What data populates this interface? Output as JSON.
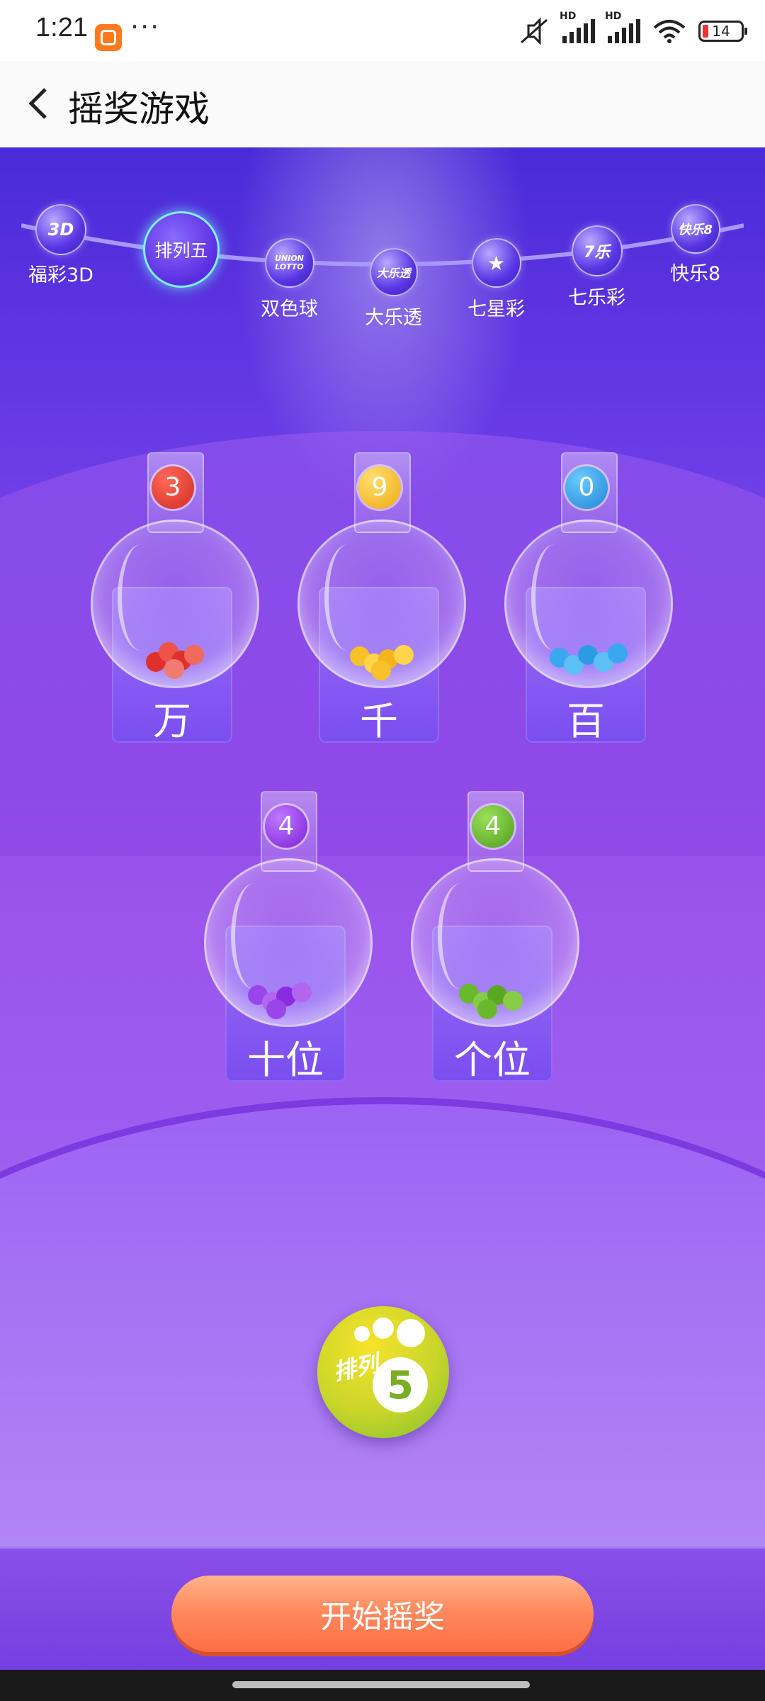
{
  "status_bar": {
    "time": "1:21",
    "dots": "···",
    "battery": "14",
    "signal_label_1": "HD",
    "signal_label_2": "HD"
  },
  "header": {
    "title": "摇奖游戏"
  },
  "lotteries": [
    {
      "label": "福彩3D",
      "badge": "3D"
    },
    {
      "label": "排列五",
      "badge": "排列五"
    },
    {
      "label": "双色球",
      "badge": "UNION LOTTO"
    },
    {
      "label": "大乐透",
      "badge": "大乐透"
    },
    {
      "label": "七星彩",
      "badge": "★"
    },
    {
      "label": "七乐彩",
      "badge": "7乐"
    },
    {
      "label": "快乐8",
      "badge": "快乐8"
    }
  ],
  "active_lottery": "排列五",
  "machines": [
    {
      "label": "万",
      "number": "3",
      "color": "#e0302c"
    },
    {
      "label": "千",
      "number": "9",
      "color": "#f4b51c"
    },
    {
      "label": "百",
      "number": "0",
      "color": "#2c9be6"
    },
    {
      "label": "十位",
      "number": "4",
      "color": "#8a2be2"
    },
    {
      "label": "个位",
      "number": "4",
      "color": "#6ab82c"
    }
  ],
  "logo": {
    "text": "排列",
    "digit": "5"
  },
  "action": {
    "start_label": "开始摇奖"
  },
  "colors": {
    "accent": "#ff7a50",
    "bg": "#6a3ce6"
  }
}
